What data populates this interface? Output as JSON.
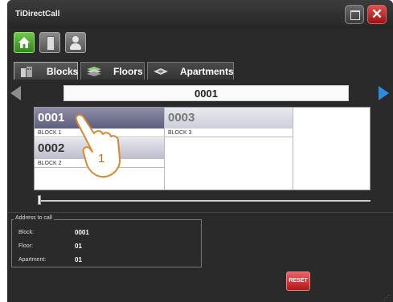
{
  "window": {
    "title": "TiDirectCall"
  },
  "tabs": [
    {
      "label": "Blocks"
    },
    {
      "label": "Floors"
    },
    {
      "label": "Apartments"
    }
  ],
  "pager": {
    "value": "0001"
  },
  "grid": {
    "cells": [
      {
        "code": "0001",
        "name": "BLOCK 1"
      },
      {
        "code": "0002",
        "name": "BLOCK 2"
      },
      {
        "code": "0003",
        "name": "BLOCK 3"
      }
    ]
  },
  "address": {
    "title": "Address to call",
    "block_label": "Block:",
    "block_value": "0001",
    "floor_label": "Floor:",
    "floor_value": "01",
    "apartment_label": "Apartment:",
    "apartment_value": "01"
  },
  "buttons": {
    "reset": "RESET"
  },
  "callout": {
    "number": "1"
  },
  "icons": {
    "close": "close-icon",
    "maximize": "maximize-icon",
    "home": "home-icon",
    "door": "door-icon",
    "user": "user-icon",
    "blocks_tab": "buildings-icon",
    "floors_tab": "floors-icon",
    "apartments_tab": "apartment-icon",
    "prev": "arrow-left-icon",
    "next": "arrow-right-icon",
    "tap": "tap-hand-icon"
  },
  "colors": {
    "accent_blue": "#2c8ae0",
    "home_green": "#4caf2a",
    "reset_red": "#d32f2f"
  }
}
